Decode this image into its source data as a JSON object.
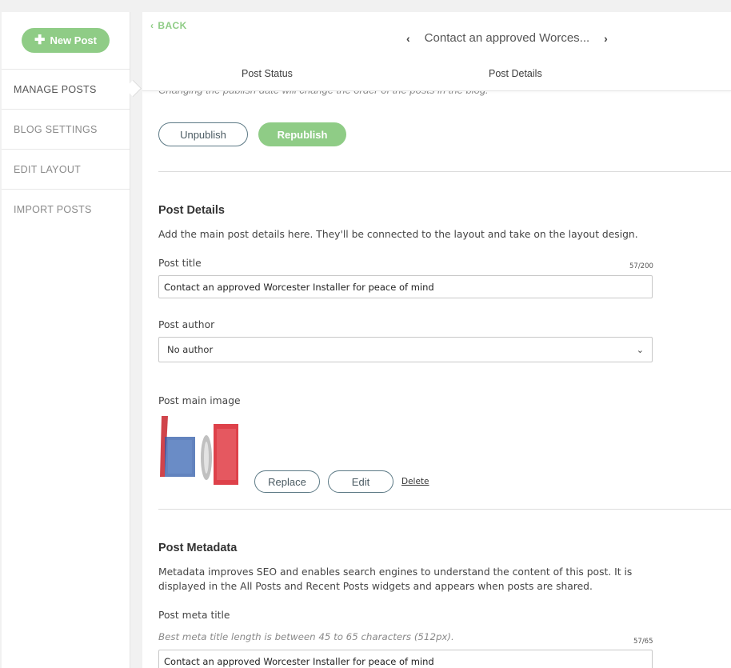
{
  "sidebar": {
    "new_post_label": "New Post",
    "items": [
      {
        "label": "MANAGE POSTS"
      },
      {
        "label": "BLOG SETTINGS"
      },
      {
        "label": "EDIT LAYOUT"
      },
      {
        "label": "IMPORT POSTS"
      }
    ]
  },
  "topbar": {
    "back_label": "BACK",
    "post_title": "Contact an approved Worces...",
    "tabs": [
      {
        "label": "Post Status"
      },
      {
        "label": "Post Details"
      }
    ]
  },
  "status_section": {
    "note": "Changing the publish date will change the order of the posts in the blog.",
    "unpublish_label": "Unpublish",
    "republish_label": "Republish"
  },
  "post_details": {
    "title": "Post Details",
    "description": "Add the main post details here. They'll be connected to the layout and take on the layout design.",
    "title_label": "Post title",
    "title_counter": "57/200",
    "title_value": "Contact an approved Worcester Installer for peace of mind",
    "author_label": "Post author",
    "author_value": "No author",
    "image_label": "Post main image",
    "replace_label": "Replace",
    "edit_label": "Edit",
    "delete_label": "Delete"
  },
  "post_metadata": {
    "title": "Post Metadata",
    "description": "Metadata improves SEO and enables search engines to understand the content of this post. It is displayed in the All Posts and Recent Posts widgets and appears when posts are shared.",
    "meta_title_label": "Post meta title",
    "meta_title_hint": "Best meta title length is between 45 to 65 characters (512px).",
    "meta_title_counter": "57/65",
    "meta_title_value": "Contact an approved Worcester Installer for peace of mind"
  },
  "colors": {
    "accent": "#8fcc86",
    "outline": "#5d7a86",
    "background": "#f1f1f1"
  },
  "icons": [
    "plus-icon",
    "chevron-left-icon",
    "chevron-right-icon",
    "chevron-down-icon"
  ]
}
